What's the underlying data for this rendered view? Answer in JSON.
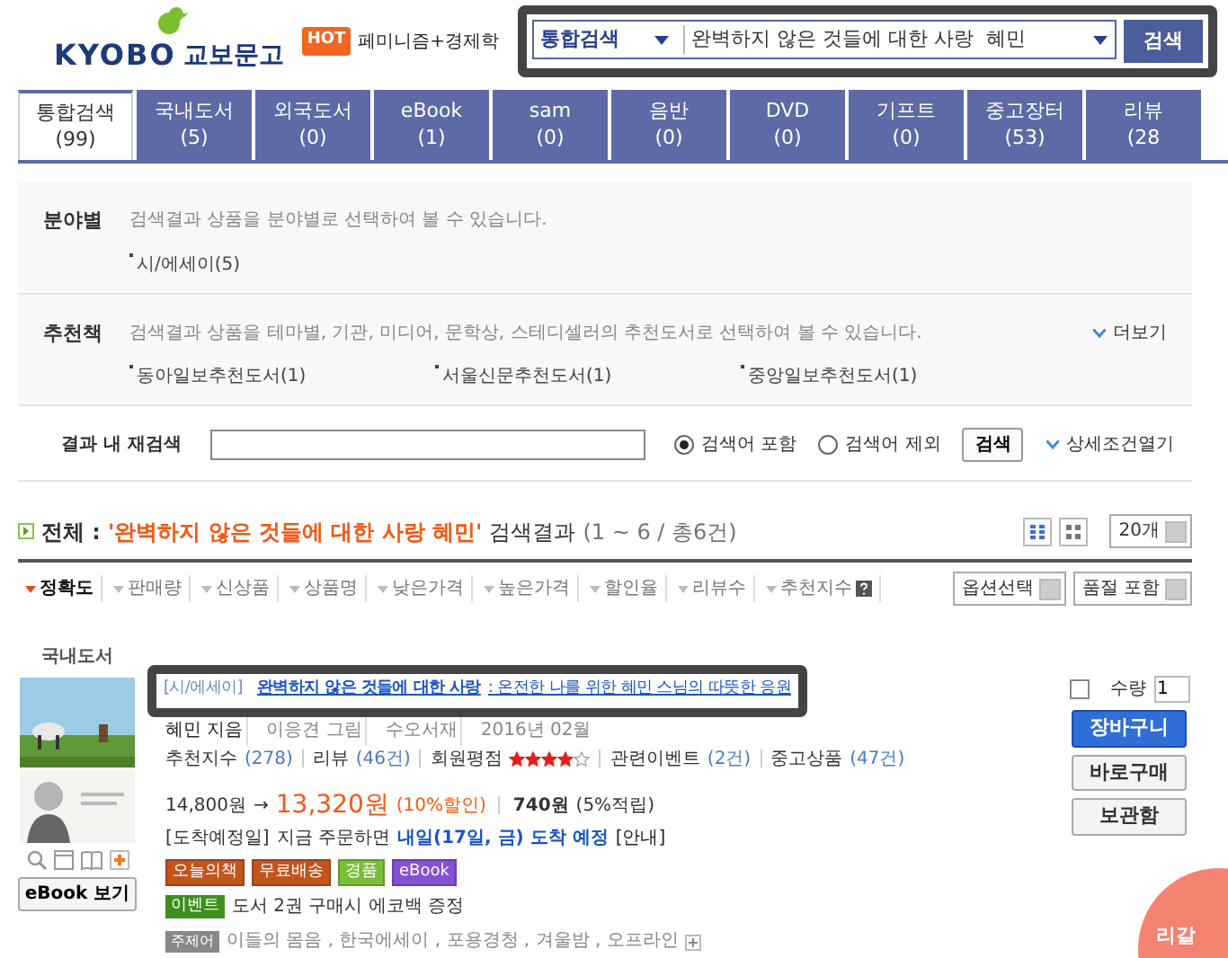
{
  "header": {
    "logo": {
      "latin": "KYOBO",
      "korean": "교보문고"
    },
    "hot_badge": "HOT",
    "hot_keyword": "페미니즘+경제학",
    "search": {
      "scope": "통합검색",
      "value": "완벽하지 않은 것들에 대한 사랑  혜민",
      "button": "검색"
    }
  },
  "tabs": [
    {
      "label": "통합검색",
      "count": "(99)",
      "selected": true
    },
    {
      "label": "국내도서",
      "count": "(5)",
      "selected": false
    },
    {
      "label": "외국도서",
      "count": "(0)",
      "selected": false
    },
    {
      "label": "eBook",
      "count": "(1)",
      "selected": false
    },
    {
      "label": "sam",
      "count": "(0)",
      "selected": false
    },
    {
      "label": "음반",
      "count": "(0)",
      "selected": false
    },
    {
      "label": "DVD",
      "count": "(0)",
      "selected": false
    },
    {
      "label": "기프트",
      "count": "(0)",
      "selected": false
    },
    {
      "label": "중고장터",
      "count": "(53)",
      "selected": false
    },
    {
      "label": "리뷰",
      "count": "(28",
      "selected": false
    }
  ],
  "filters": [
    {
      "label": "분야별",
      "description": "검색결과 상품을 분야별로 선택하여 볼 수 있습니다.",
      "options": [
        "시/에세이(5)"
      ]
    },
    {
      "label": "추천책",
      "description": "검색결과 상품을 테마별, 기관, 미디어, 문학상, 스테디셀러의 추천도서로 선택하여 볼 수 있습니다.",
      "options": [
        "동아일보추천도서(1)",
        "서울신문추천도서(1)",
        "중앙일보추천도서(1)"
      ],
      "more": "더보기"
    }
  ],
  "refine": {
    "label": "결과 내 재검색",
    "options": [
      {
        "label": "검색어 포함",
        "selected": true
      },
      {
        "label": "검색어 제외",
        "selected": false
      }
    ],
    "button": "검색",
    "detail_link": "상세조건열기"
  },
  "summary": {
    "label": "전체",
    "colon": ":",
    "query": "'완벽하지 않은 것들에 대한 사랑 혜민'",
    "suffix": "검색결과",
    "range": "(1 ~ 6 / 총6건)",
    "page_size": "20개"
  },
  "sort": [
    {
      "label": "정확도",
      "selected": true,
      "help": false
    },
    {
      "label": "판매량",
      "selected": false,
      "help": false
    },
    {
      "label": "신상품",
      "selected": false,
      "help": false
    },
    {
      "label": "상품명",
      "selected": false,
      "help": false
    },
    {
      "label": "낮은가격",
      "selected": false,
      "help": false
    },
    {
      "label": "높은가격",
      "selected": false,
      "help": false
    },
    {
      "label": "할인율",
      "selected": false,
      "help": false
    },
    {
      "label": "리뷰수",
      "selected": false,
      "help": false
    },
    {
      "label": "추천지수",
      "selected": false,
      "help": true
    }
  ],
  "sort_selects": [
    "옵션선택",
    "품절 포함"
  ],
  "result": {
    "category": "국내도서",
    "ebook_button": "eBook 보기",
    "genre": "[시/에세이]",
    "title": "완벽하지 않은 것들에 대한 사랑",
    "subtitle": ": 온전한 나를 위한 혜민 스님의 따뜻한 응원",
    "credits": [
      "혜민 지음",
      "이응견 그림",
      "수오서재",
      "2016년 02월"
    ],
    "stats": [
      {
        "kind": "count",
        "label": "추천지수",
        "value": "(278)"
      },
      {
        "kind": "count",
        "label": "리뷰",
        "value": "(46건)"
      },
      {
        "kind": "rating",
        "label": "회원평점",
        "stars": 4
      },
      {
        "kind": "count",
        "label": "관련이벤트",
        "value": "(2건)"
      },
      {
        "kind": "count",
        "label": "중고상품",
        "value": "(47건)"
      }
    ],
    "price": {
      "list": "14,800원",
      "arrow": "→",
      "sale": "13,320원",
      "discount": "(10%할인)",
      "points": "740원",
      "points_rate": "(5%적립)"
    },
    "delivery": {
      "label": "[도착예정일]",
      "text": "지금 주문하면",
      "date": "내일(17일, 금) 도착 예정",
      "info": "[안내]"
    },
    "badges": [
      {
        "label": "오늘의책",
        "color": "#c2541e"
      },
      {
        "label": "무료배송",
        "color": "#c2541e"
      },
      {
        "label": "경품",
        "color": "#7cbd3a"
      },
      {
        "label": "eBook",
        "color": "#8650d6"
      }
    ],
    "event": {
      "badge": "이벤트",
      "text": "도서 2권 구매시 에코백 증정"
    },
    "keywords": {
      "label": "주제어",
      "text": "이들의 몸음 , 한국에세이 , 포용경청 , 겨울밤 , 오프라인"
    },
    "cart": {
      "checked": false,
      "quantity_label": "수량",
      "quantity": "1",
      "buttons": [
        {
          "label": "장바구니",
          "kind": "primary"
        },
        {
          "label": "바로구매",
          "kind": "plain"
        },
        {
          "label": "보관함",
          "kind": "plain"
        }
      ]
    }
  },
  "floating_banner": "리갈"
}
